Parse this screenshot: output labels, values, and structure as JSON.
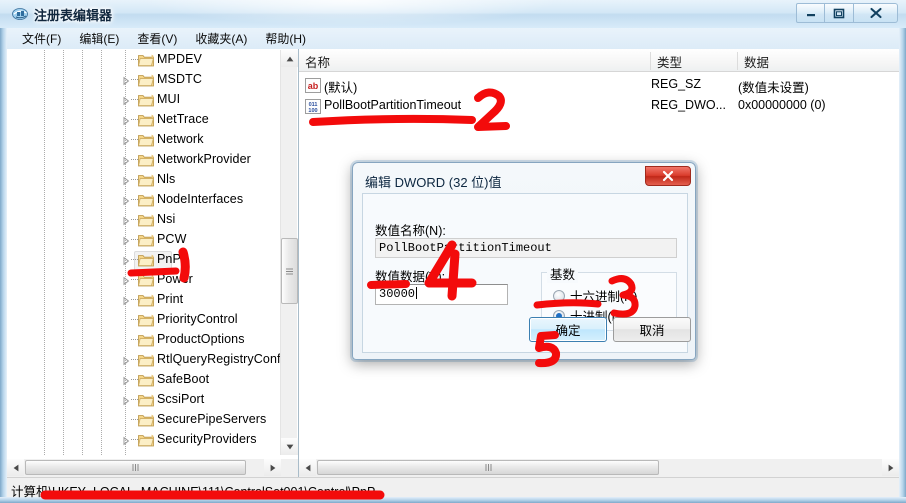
{
  "window": {
    "title": "注册表编辑器",
    "icon": "registry-editor-icon",
    "controls": {
      "minimize": "minimize-icon",
      "maximize": "maximize-icon",
      "close": "close-icon"
    }
  },
  "menubar": {
    "items": [
      {
        "label": "文件(F)"
      },
      {
        "label": "编辑(E)"
      },
      {
        "label": "查看(V)"
      },
      {
        "label": "收藏夹(A)"
      },
      {
        "label": "帮助(H)"
      }
    ]
  },
  "tree": {
    "items": [
      {
        "label": "MPDEV",
        "expandable": false,
        "selected": false
      },
      {
        "label": "MSDTC",
        "expandable": true,
        "selected": false
      },
      {
        "label": "MUI",
        "expandable": true,
        "selected": false
      },
      {
        "label": "NetTrace",
        "expandable": true,
        "selected": false
      },
      {
        "label": "Network",
        "expandable": true,
        "selected": false
      },
      {
        "label": "NetworkProvider",
        "expandable": true,
        "selected": false
      },
      {
        "label": "Nls",
        "expandable": true,
        "selected": false
      },
      {
        "label": "NodeInterfaces",
        "expandable": true,
        "selected": false
      },
      {
        "label": "Nsi",
        "expandable": true,
        "selected": false
      },
      {
        "label": "PCW",
        "expandable": true,
        "selected": false
      },
      {
        "label": "PnP",
        "expandable": true,
        "selected": true
      },
      {
        "label": "Power",
        "expandable": true,
        "selected": false
      },
      {
        "label": "Print",
        "expandable": true,
        "selected": false
      },
      {
        "label": "PriorityControl",
        "expandable": false,
        "selected": false
      },
      {
        "label": "ProductOptions",
        "expandable": false,
        "selected": false
      },
      {
        "label": "RtlQueryRegistryConfi",
        "expandable": true,
        "selected": false
      },
      {
        "label": "SafeBoot",
        "expandable": true,
        "selected": false
      },
      {
        "label": "ScsiPort",
        "expandable": true,
        "selected": false
      },
      {
        "label": "SecurePipeServers",
        "expandable": false,
        "selected": false
      },
      {
        "label": "SecurityProviders",
        "expandable": true,
        "selected": false
      }
    ]
  },
  "list": {
    "columns": [
      {
        "label": "名称"
      },
      {
        "label": "类型"
      },
      {
        "label": "数据"
      }
    ],
    "rows": [
      {
        "icon": "string-value-icon",
        "name": "(默认)",
        "type": "REG_SZ",
        "data": "(数值未设置)"
      },
      {
        "icon": "binary-value-icon",
        "name": "PollBootPartitionTimeout",
        "type": "REG_DWO...",
        "data": "0x00000000 (0)"
      }
    ]
  },
  "statusbar": {
    "path": "计算机\\HKEY_LOCAL_MACHINE\\111\\ControlSet001\\Control\\PnP"
  },
  "dialog": {
    "title": "编辑 DWORD (32 位)值",
    "close_label": "x",
    "name_label": "数值名称(N):",
    "name_value": "PollBootPartitionTimeout",
    "data_label": "数值数据(V):",
    "data_value": "30000",
    "base_legend": "基数",
    "base_options": [
      {
        "label": "十六进制(H)",
        "checked": false
      },
      {
        "label": "十进制(D)",
        "checked": true
      }
    ],
    "ok_label": "确定",
    "cancel_label": "取消"
  },
  "annotations": {
    "color": "#f30b0b",
    "marks": [
      {
        "id": "1",
        "label": "1",
        "target": "tree-item-pnp"
      },
      {
        "id": "2",
        "label": "2",
        "target": "list-row-pollbootpartitiontimeout"
      },
      {
        "id": "3",
        "label": "3",
        "target": "radio-decimal"
      },
      {
        "id": "4",
        "label": "4",
        "target": "data-value-input"
      },
      {
        "id": "5",
        "label": "5",
        "target": "ok-button"
      }
    ]
  }
}
